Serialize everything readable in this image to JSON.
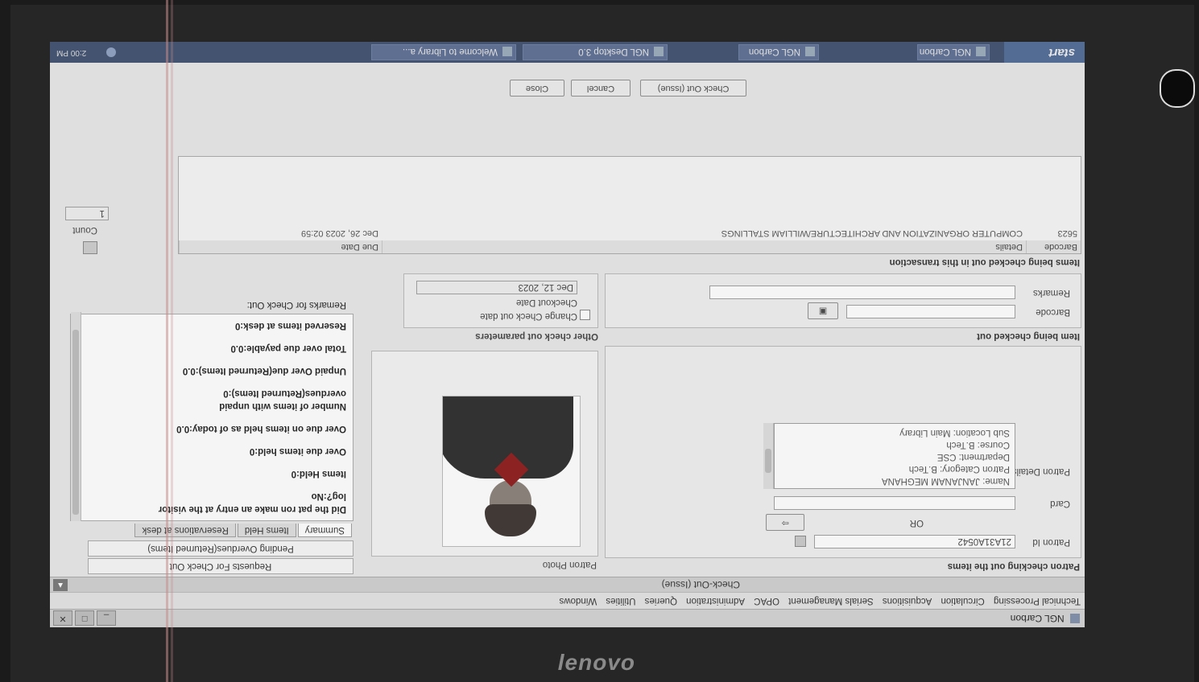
{
  "screen_orientation": "rotated 180 degrees (photo of monitor taken upside-down)",
  "bezel": {
    "brand": "lenovo"
  },
  "window": {
    "app_title": "NGL Carbon",
    "buttons": [
      "_",
      "□",
      "✕"
    ]
  },
  "menu": [
    "Technical Processing",
    "Circulation",
    "Acquisitions",
    "Serials Management",
    "OPAC",
    "Administration",
    "Queries",
    "Utilities",
    "Windows"
  ],
  "dialog": {
    "title": "Check-Out (Issue)"
  },
  "patron": {
    "group_title": "Patron checking out the items",
    "patron_id_label": "Patron Id",
    "patron_id_value": "21A31A0542",
    "or_label": "OR",
    "card_label": "Card",
    "details_label": "Patron Details",
    "details_lines": [
      "Name: JANJANAM MEGHANA",
      "Patron Category: B.Tech",
      "Department: CSE",
      "Course: B.Tech",
      "Sub Location: Main Library"
    ],
    "photo_label": "Patron Photo"
  },
  "item": {
    "group_title": "Item being checked out",
    "barcode_label": "Barcode",
    "barcode_value": "",
    "remarks_label": "Remarks",
    "other_params_title": "Other check out parameters",
    "change_date_label": "Change Check out date",
    "checkout_date_label": "Checkout Date",
    "checkout_date_value": "Dec 12, 2023"
  },
  "transaction": {
    "group_title": "Items being checked out in this transaction",
    "columns": [
      "Barcode",
      "Details",
      "Due Date"
    ],
    "rows": [
      {
        "barcode": "5623",
        "details": "COMPUTER ORGANIZATION AND ARCHITECTURE/WILLIAM STALLINGS",
        "due_date": "Dec 26, 2023 02:59"
      }
    ],
    "count_label": "Count",
    "count_value": "1"
  },
  "sidebar": {
    "links": [
      "Requests For Check Out",
      "Pending Overdues(Returned Items)"
    ],
    "tabs": [
      "Summary",
      "Items Held",
      "Reservations at desk"
    ],
    "summary_lines": [
      {
        "text": "Did the pat ron make an entry at the visitor",
        "bold": true
      },
      {
        "text": "log?:No",
        "bold": false
      },
      {
        "text": "Items Held:0",
        "bold": false
      },
      {
        "text": "Over due items held:0",
        "bold": false
      },
      {
        "text": "Over due on items held as of today:0.0",
        "bold": false
      },
      {
        "text": "Number of items with unpaid",
        "bold": false
      },
      {
        "text": "overdues(Returned Items):0",
        "bold": false
      },
      {
        "text": "Unpaid Over due(Returned Items):0.0",
        "bold": false
      },
      {
        "text": "Total over due payable:0.0",
        "bold": false
      },
      {
        "text": "Reserved items at desk:0",
        "bold": false
      },
      {
        "text": "Remarks for Check Out:",
        "bold": false
      }
    ]
  },
  "actions": {
    "checkout": "Check Out (Issue)",
    "cancel": "Cancel",
    "close": "Close"
  },
  "taskbar": {
    "start": "start",
    "tasks": [
      "NGL Carbon",
      "NGL Carbon",
      "NGL Desktop 3.0",
      "Welcome to Library a..."
    ],
    "clock": "2:00 PM"
  },
  "colors": {
    "taskbar": "#3e4f6f",
    "window_bg": "#e7e7e7",
    "bezel": "#262626"
  }
}
